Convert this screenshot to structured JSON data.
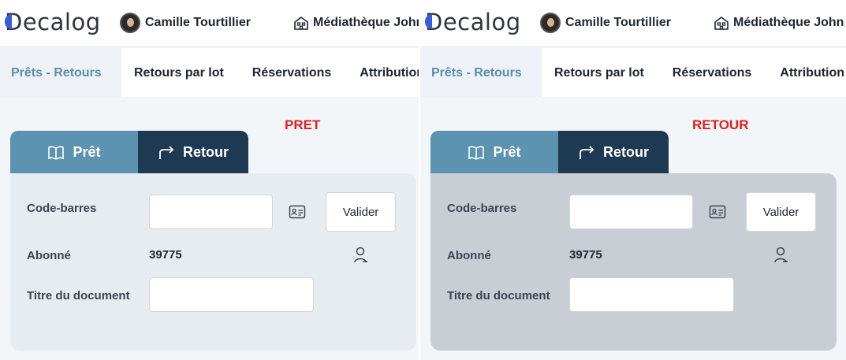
{
  "app": {
    "logo": "Decalog"
  },
  "header": {
    "user_name": "Camille Tourtillier",
    "library_name": "Médiathèque John"
  },
  "nav": {
    "tabs": [
      "Prêts - Retours",
      "Retours par lot",
      "Réservations",
      "Attribution"
    ]
  },
  "modes": {
    "pret_label": "Prêt",
    "retour_label": "Retour"
  },
  "panels": [
    {
      "annotation": "PRET"
    },
    {
      "annotation": "RETOUR"
    }
  ],
  "form": {
    "barcode_label": "Code-barres",
    "barcode_value": "",
    "validate_label": "Valider",
    "subscriber_label": "Abonné",
    "subscriber_value": "39775",
    "title_label": "Titre du document",
    "title_value": ""
  },
  "colors": {
    "accent": "#5b93b1",
    "dark": "#1d3a52",
    "annotation": "#e02020"
  }
}
